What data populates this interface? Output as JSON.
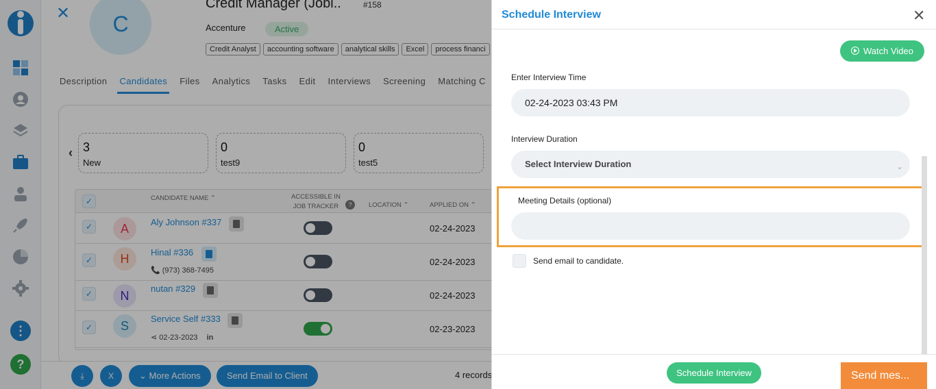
{
  "job": {
    "avatar_letter": "C",
    "title": "Credit Manager (Jobi..",
    "id": "#158",
    "company": "Accenture",
    "status": "Active",
    "skills": [
      "Credit Analyst",
      "accounting software",
      "analytical skills",
      "Excel",
      "process financi"
    ]
  },
  "tabs": [
    "Description",
    "Candidates",
    "Files",
    "Analytics",
    "Tasks",
    "Edit",
    "Interviews",
    "Screening",
    "Matching C"
  ],
  "stages": [
    {
      "count": "3",
      "label": "New"
    },
    {
      "count": "0",
      "label": "test9"
    },
    {
      "count": "0",
      "label": "test5"
    }
  ],
  "table": {
    "headers": {
      "name": "CANDIDATE NAME",
      "accessible_line1": "ACCESSIBLE IN",
      "accessible_line2": "JOB TRACKER",
      "location": "LOCATION",
      "applied": "APPLIED ON"
    },
    "rows": [
      {
        "letter": "A",
        "name": "Aly Johnson #337",
        "sub": "",
        "applied": "02-24-2023",
        "accessible": false
      },
      {
        "letter": "H",
        "name": "Hinal #336",
        "sub": "(973) 368-7495",
        "applied": "02-24-2023",
        "accessible": false
      },
      {
        "letter": "N",
        "name": "nutan #329",
        "sub": "",
        "applied": "02-24-2023",
        "accessible": false
      },
      {
        "letter": "S",
        "name": "Service Self #333",
        "sub": "02-23-2023",
        "applied": "02-23-2023",
        "accessible": true
      }
    ]
  },
  "bottom": {
    "more_actions": "More Actions",
    "send_email_client": "Send Email to Client",
    "records": "4 records"
  },
  "drawer": {
    "title": "Schedule Interview",
    "watch_video": "Watch Video",
    "time_label": "Enter Interview Time",
    "time_value": "02-24-2023 03:43 PM",
    "duration_label": "Interview Duration",
    "duration_placeholder": "Select Interview Duration",
    "meeting_label": "Meeting Details (optional)",
    "meeting_value": "",
    "send_email_label": "Send email to candidate.",
    "schedule_button": "Schedule Interview",
    "send_message": "Send mes..."
  },
  "colors": {
    "accent": "#1f8ad6",
    "success": "#3fc380",
    "highlight": "#f0a23c",
    "send_message": "#f28c3a"
  }
}
